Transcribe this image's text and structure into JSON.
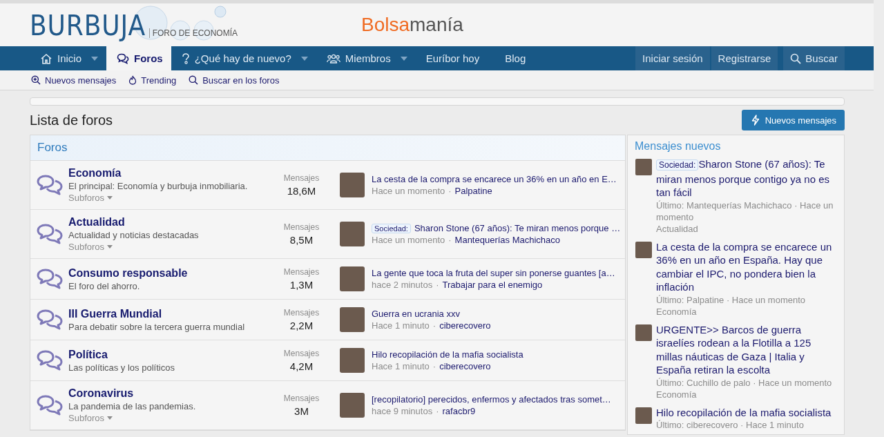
{
  "header": {
    "logo": {
      "name": "BURBUJA",
      "tagline": "FORO DE ECONOMÍA"
    },
    "partner": {
      "first": "Bolsa",
      "second": "manía"
    }
  },
  "nav": {
    "items": [
      {
        "label": "Inicio",
        "dropdown": true,
        "selected": false
      },
      {
        "label": "Foros",
        "dropdown": false,
        "selected": true
      },
      {
        "label": "¿Qué hay de nuevo?",
        "dropdown": true,
        "selected": false
      },
      {
        "label": "Miembros",
        "dropdown": true,
        "selected": false
      },
      {
        "label": "Euríbor hoy",
        "dropdown": false,
        "selected": false
      },
      {
        "label": "Blog",
        "dropdown": false,
        "selected": false
      }
    ],
    "account": [
      "Iniciar sesión",
      "Registrarse"
    ],
    "search": "Buscar"
  },
  "subnav": [
    {
      "label": "Nuevos mensajes"
    },
    {
      "label": "Trending"
    },
    {
      "label": "Buscar en los foros"
    }
  ],
  "page_title": "Lista de foros",
  "new_posts_button": "Nuevos mensajes",
  "forums": {
    "title": "Foros",
    "rows": [
      {
        "name": "Economía",
        "description": "El principal: Economía y burbuja inmobiliaria.",
        "subforums": "Subforos",
        "stat_label": "Mensajes",
        "stat_value": "18,6M",
        "latest": {
          "title": "La cesta de la compra se encarece un 36% en un año en E…",
          "time": "Hace un momento",
          "separator": "·",
          "author": "Palpatine"
        }
      },
      {
        "name": "Actualidad",
        "description": "Actualidad y noticias destacadas",
        "subforums": "Subforos",
        "stat_label": "Mensajes",
        "stat_value": "8,5M",
        "latest": {
          "prefix": "Sociedad:",
          "title": "Sharon Stone (67 años): Te miran menos porque …",
          "time": "Hace un momento",
          "separator": "·",
          "author": "Mantequerías Machichaco"
        }
      },
      {
        "name": "Consumo responsable",
        "description": "El foro del ahorro.",
        "stat_label": "Mensajes",
        "stat_value": "1,3M",
        "latest": {
          "title": "La gente que toca la fruta del super sin ponerse guantes [a…",
          "time": "hace 2 minutos",
          "separator": "·",
          "author": "Trabajar para el enemigo"
        }
      },
      {
        "name": "III Guerra Mundial",
        "description": "Para debatir sobre la tercera guerra mundial",
        "stat_label": "Mensajes",
        "stat_value": "2,2M",
        "latest": {
          "title": "Guerra en ucrania xxv",
          "time": "Hace 1 minuto",
          "separator": "·",
          "author": "ciberecovero"
        }
      },
      {
        "name": "Política",
        "description": "Las políticas y los políticos",
        "stat_label": "Mensajes",
        "stat_value": "4,2M",
        "latest": {
          "title": "Hilo recopilación de la mafia socialista",
          "time": "Hace 1 minuto",
          "separator": "·",
          "author": "ciberecovero"
        }
      },
      {
        "name": "Coronavirus",
        "description": "La pandemia de las pandemias.",
        "subforums": "Subforos",
        "stat_label": "Mensajes",
        "stat_value": "3M",
        "latest": {
          "title": "[recopilatorio] perecidos, enfermos y afectados tras somet…",
          "time": "hace 9 minutos",
          "separator": "·",
          "author": "rafacbr9"
        }
      }
    ]
  },
  "sidebar": {
    "title": "Mensajes nuevos",
    "items": [
      {
        "prefix": "Sociedad:",
        "title": "Sharon Stone (67 años): Te miran menos porque contigo ya no es tan fácil",
        "meta": "Último: Mantequerías Machichaco · Hace un momento",
        "forum": "Actualidad"
      },
      {
        "title": "La cesta de la compra se encarece un 36% en un año en España. Hay que cambiar el IPC, no pondera bien la inflación",
        "meta": "Último: Palpatine · Hace un momento",
        "forum": "Economía"
      },
      {
        "title": "URGENTE>> Barcos de guerra israelíes rodean a la Flotilla a 125 millas náuticas de Gaza | Italia y España retiran la escolta",
        "meta": "Último: Cuchillo de palo · Hace un momento",
        "forum": "Economía"
      },
      {
        "title": "Hilo recopilación de la mafia socialista",
        "meta": "Último: ciberecovero · Hace 1 minuto"
      }
    ]
  }
}
